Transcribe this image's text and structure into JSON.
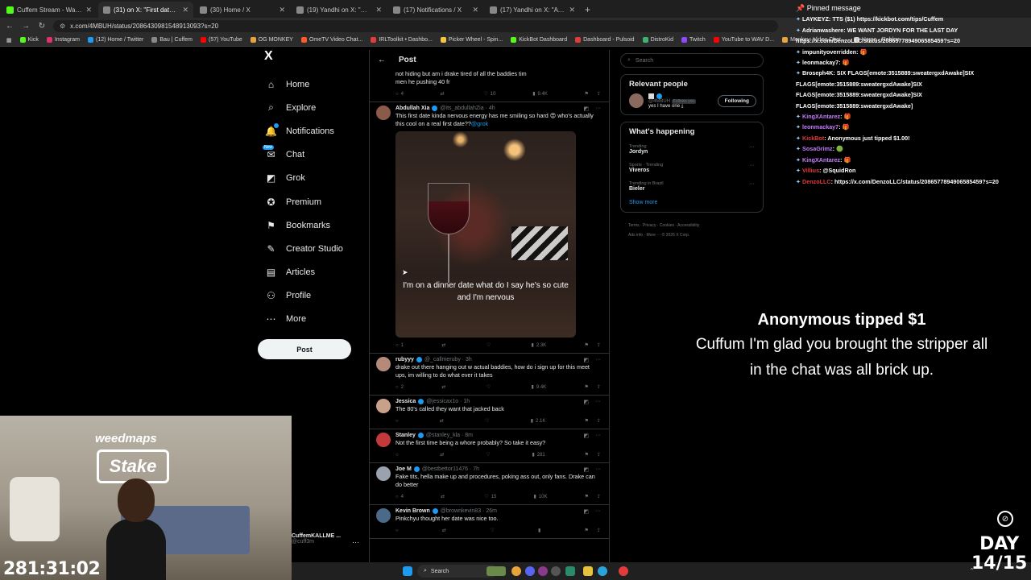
{
  "browser": {
    "tabs": [
      {
        "title": "Cuffem Stream - Watch Live on",
        "color": "#53fc18",
        "active": false
      },
      {
        "title": "(31) on X: \"First date kinda",
        "color": "#888888",
        "active": true
      },
      {
        "title": "(30) Home / X",
        "color": "#888888",
        "active": false
      },
      {
        "title": "(19) Yandhi on X: \"WTF https:",
        "color": "#888888",
        "active": false
      },
      {
        "title": "(17) Notifications / X",
        "color": "#888888",
        "active": false
      },
      {
        "title": "(17) Yandhi on X: \"A walking p",
        "color": "#888888",
        "active": false
      }
    ],
    "new_tab": "+",
    "address": "x.com/4MBUH/status/2086430981548913093?s=20",
    "bookmarks": [
      {
        "label": "Kick",
        "color": "#53fc18"
      },
      {
        "label": "Instagram",
        "color": "#e1306c"
      },
      {
        "label": "(12) Home / Twitter",
        "color": "#1d9bf0"
      },
      {
        "label": "Bau | Cuffem",
        "color": "#888888"
      },
      {
        "label": "(57) YouTube",
        "color": "#ff0000"
      },
      {
        "label": "OG MONKEY",
        "color": "#e8a33c"
      },
      {
        "label": "OmeTV Video Chat...",
        "color": "#ff5a2a"
      },
      {
        "label": "IRLToolkit • Dashbo...",
        "color": "#e23b3b"
      },
      {
        "label": "Picker Wheel - Spin...",
        "color": "#f5c542"
      },
      {
        "label": "KickBot Dashboard",
        "color": "#53fc18"
      },
      {
        "label": "Dashboard - Pulsoid",
        "color": "#e23b3b"
      },
      {
        "label": "DistroKid",
        "color": "#3cb371"
      },
      {
        "label": "Twitch",
        "color": "#9146ff"
      },
      {
        "label": "YouTube to WAV D...",
        "color": "#ff0000"
      },
      {
        "label": "Monkey: Video Chat...",
        "color": "#e8a33c"
      },
      {
        "label": "Home - Roblox",
        "color": "#cccccc"
      }
    ]
  },
  "x_nav": {
    "logo": "X",
    "items": [
      {
        "key": "home",
        "label": "Home",
        "icon": "home-icon",
        "glyph": "⌂"
      },
      {
        "key": "explore",
        "label": "Explore",
        "icon": "search-icon",
        "glyph": "⌕"
      },
      {
        "key": "notifications",
        "label": "Notifications",
        "icon": "bell-icon",
        "glyph": "🔔"
      },
      {
        "key": "chat",
        "label": "Chat",
        "icon": "chat-icon",
        "glyph": "✉"
      },
      {
        "key": "grok",
        "label": "Grok",
        "icon": "grok-icon",
        "glyph": "◩"
      },
      {
        "key": "premium",
        "label": "Premium",
        "icon": "premium-icon",
        "glyph": "✪"
      },
      {
        "key": "bookmarks",
        "label": "Bookmarks",
        "icon": "bookmark-icon",
        "glyph": "⚑"
      },
      {
        "key": "creator-studio",
        "label": "Creator Studio",
        "icon": "creator-studio-icon",
        "glyph": "✎"
      },
      {
        "key": "articles",
        "label": "Articles",
        "icon": "articles-icon",
        "glyph": "▤"
      },
      {
        "key": "profile",
        "label": "Profile",
        "icon": "profile-icon",
        "glyph": "⚇"
      },
      {
        "key": "more",
        "label": "More",
        "icon": "more-icon",
        "glyph": "⋯"
      }
    ],
    "chat_badge": "New",
    "post_label": "Post",
    "account_name": "CuffemKALLME ...",
    "account_handle": "@cuff3m"
  },
  "main": {
    "title": "Post",
    "partial_top": {
      "text": "not hiding but am i drake tired of all the baddies tim men he pushing 40 fr",
      "actions": [
        "4",
        "",
        "10",
        "9.4K"
      ]
    },
    "tweets": [
      {
        "name": "Abdullah Xia",
        "handle": "@its_abdullahZia · 4h",
        "avatar_color": "#8a5a4a",
        "text": "This first date kinda nervous energy has me smiling so hard 😍 who's actually this cool on a real first date??",
        "mention": "@grok",
        "has_media": true,
        "media_caption": "I'm on a dinner date what do I say he's so cute and I'm nervous",
        "actions": [
          "1",
          "",
          "",
          "2.3K"
        ]
      },
      {
        "name": "rubyyy",
        "handle": "@_callmeruby · 3h",
        "avatar_color": "#b58a7a",
        "text": "drake out there hanging out w actual baddies, how do i sign up for this meet ups, im willing to do what ever it takes",
        "mention": "",
        "has_media": false,
        "actions": [
          "2",
          "",
          "",
          "9.4K"
        ]
      },
      {
        "name": "Jessica",
        "handle": "@jessicax1o · 1h",
        "avatar_color": "#c9a08a",
        "text": "The 80's called they want that jacked back",
        "mention": "",
        "has_media": false,
        "actions": [
          "",
          "",
          "",
          "2.1K"
        ]
      },
      {
        "name": "Stanley",
        "handle": "@stanley_kla · 8m",
        "avatar_color": "#c23a3a",
        "text": "Not the first time being a whore probably? So take it easy?",
        "mention": "",
        "has_media": false,
        "actions": [
          "",
          "",
          "",
          "281"
        ]
      },
      {
        "name": "Joe M",
        "handle": "@bestbettor11476 · 7h",
        "avatar_color": "#9aa3ad",
        "text": "Fake tits, hella make up and procedures, poking ass out, only fans. Drake can do better",
        "mention": "",
        "has_media": false,
        "actions": [
          "4",
          "",
          "15",
          "10K"
        ]
      },
      {
        "name": "Kevin Brown",
        "handle": "@brownkevin83 · 26m",
        "avatar_color": "#4a6a8a",
        "text": "Pinkchyu thought her date was nice too.",
        "mention": "",
        "has_media": false,
        "actions": [
          "",
          "",
          "",
          ""
        ]
      }
    ]
  },
  "sidebar_right": {
    "search_placeholder": "Search",
    "relevant_title": "Relevant people",
    "person_handle": "@4MBUH",
    "person_follows": "Follows you",
    "person_bio": "yes I have one ⤓",
    "following_label": "Following",
    "happening_title": "What's happening",
    "trends": [
      {
        "context": "Trending",
        "name": "Jordyn"
      },
      {
        "context": "Sports · Trending",
        "name": "Viveros"
      },
      {
        "context": "Trending in Brazil",
        "name": "Bieler"
      }
    ],
    "show_more": "Show more",
    "footer_line1": "Terms · Privacy · Cookies · Accessibility",
    "footer_line2": "Ads info · More ··· © 2026 X Corp."
  },
  "chat": {
    "pinned_label": "Pinned message",
    "lines": [
      {
        "user": "LAYKEYZ",
        "color": "#ffffff",
        "text": "TTS ($1) https://kickbot.com/tips/Cuffem"
      },
      {
        "user": "Adrianwashere",
        "color": "#ffffff",
        "text": "WE WANT JORDYN FOR THE LAST DAY"
      },
      {
        "user": "",
        "color": "#ffffff",
        "text": "https://x.com/DenzoLLC/status/2086577894906585459?s=20"
      },
      {
        "user": "impunityoverridden",
        "color": "#ffffff",
        "text": "🎁"
      },
      {
        "user": "leonmackay7",
        "color": "#ffffff",
        "text": "🎁"
      },
      {
        "user": "Broseph4K",
        "color": "#ffffff",
        "text": "SIX FLAGS[emote:3515889:sweatergxdAwake]SIX"
      },
      {
        "user": "",
        "color": "#ffffff",
        "text": "FLAGS[emote:3515889:sweatergxdAwake]SIX"
      },
      {
        "user": "",
        "color": "#ffffff",
        "text": "FLAGS[emote:3515889:sweatergxdAwake]SIX"
      },
      {
        "user": "",
        "color": "#ffffff",
        "text": "FLAGS[emote:3515889:sweatergxdAwake]"
      },
      {
        "user": "KingXAntarez",
        "color": "#c77dff",
        "text": "🎁"
      },
      {
        "user": "leonmackay7",
        "color": "#c77dff",
        "text": "🎁"
      },
      {
        "user": "KickBot",
        "color": "#e23b3b",
        "text": "Anonymous just tipped $1.00!"
      },
      {
        "user": "SosaGrimz",
        "color": "#c77dff",
        "text": "🟢"
      },
      {
        "user": "KingXAntarez",
        "color": "#c77dff",
        "text": "🎁"
      },
      {
        "user": "Villius",
        "color": "#e23b3b",
        "text": "@SquidRon"
      },
      {
        "user": "DenzoLLC",
        "color": "#e23b3b",
        "text": "https://x.com/DenzoLLC/status/2086577894906585459?s=20"
      }
    ]
  },
  "alert": {
    "title": "Anonymous tipped $1",
    "message": "Cuffum I'm glad you brought the stripper all in the chat was all brick up."
  },
  "webcam": {
    "sign_brand": "weedmaps",
    "sign_logo": "Stake",
    "timer": "281:31:02"
  },
  "taskbar": {
    "search_label": "Search"
  },
  "overlay": {
    "day_line1": "DAY",
    "day_line2": "14/15"
  }
}
